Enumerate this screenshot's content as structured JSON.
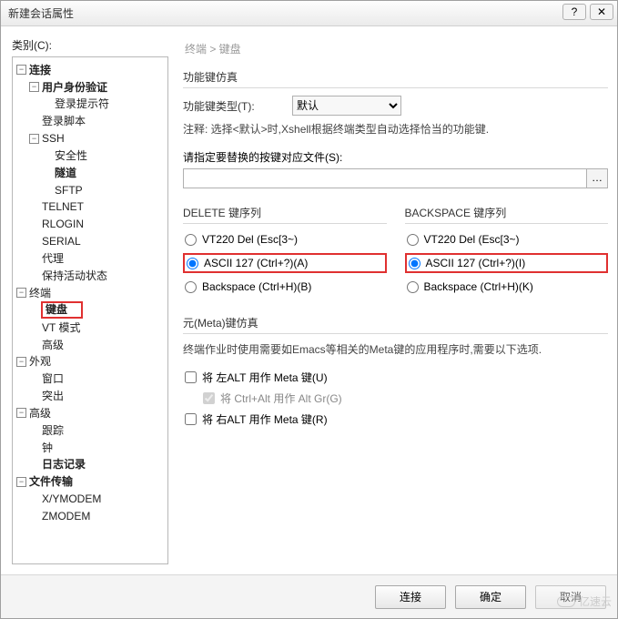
{
  "window": {
    "title": "新建会话属性",
    "help": "?",
    "close": "✕"
  },
  "sidebar": {
    "label": "类别(C):",
    "tree": {
      "connect": "连接",
      "auth": "用户身份验证",
      "prompt": "登录提示符",
      "script": "登录脚本",
      "ssh": "SSH",
      "security": "安全性",
      "tunnel": "隧道",
      "sftp": "SFTP",
      "telnet": "TELNET",
      "rlogin": "RLOGIN",
      "serial": "SERIAL",
      "proxy": "代理",
      "keepalive": "保持活动状态",
      "terminal": "终端",
      "keyboard": "键盘",
      "vtmode": "VT 模式",
      "adv1": "高级",
      "appearance": "外观",
      "windowopt": "窗口",
      "highlight": "突出",
      "advanced": "高级",
      "trace": "跟踪",
      "bell": "钟",
      "logging": "日志记录",
      "filetransfer": "文件传输",
      "xymodem": "X/YMODEM",
      "zmodem": "ZMODEM"
    }
  },
  "breadcrumb": "终端 > 键盘",
  "groups": {
    "fnKeys": {
      "title": "功能键仿真",
      "typeLabel": "功能键类型(T):",
      "typeValue": "默认",
      "hint": "注释: 选择<默认>时,Xshell根据终端类型自动选择恰当的功能键.",
      "fileLabel": "请指定要替换的按键对应文件(S):",
      "browse": "…"
    },
    "delete": {
      "title": "DELETE 键序列",
      "opt1": "VT220 Del (Esc[3~)",
      "opt2": "ASCII 127 (Ctrl+?)(A)",
      "opt3": "Backspace (Ctrl+H)(B)"
    },
    "backspace": {
      "title": "BACKSPACE 键序列",
      "opt1": "VT220 Del (Esc[3~)",
      "opt2": "ASCII 127 (Ctrl+?)(I)",
      "opt3": "Backspace (Ctrl+H)(K)"
    },
    "meta": {
      "title": "元(Meta)键仿真",
      "hint": "终端作业时使用需要如Emacs等相关的Meta键的应用程序时,需要以下选项.",
      "leftAlt": "将 左ALT 用作 Meta 键(U)",
      "ctrlAlt": "将 Ctrl+Alt 用作 Alt Gr(G)",
      "rightAlt": "将 右ALT 用作 Meta 键(R)"
    }
  },
  "buttons": {
    "connect": "连接",
    "ok": "确定",
    "cancel": "取消"
  },
  "watermark": "亿速云"
}
